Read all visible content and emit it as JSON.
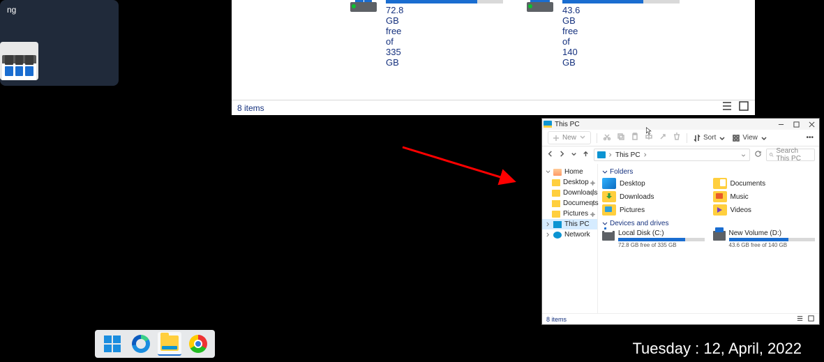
{
  "tl_card": {
    "title_line1": "ng"
  },
  "bg_explorer": {
    "drive1": {
      "capacity_text": "72.8 GB free of 335 GB",
      "fill_pct": 78
    },
    "drive2": {
      "capacity_text": "43.6 GB free of 140 GB",
      "fill_pct": 69
    },
    "status_items": "8 items"
  },
  "sm_explorer": {
    "title": "This PC",
    "toolbar": {
      "new_label": "New",
      "sort_label": "Sort",
      "view_label": "View"
    },
    "breadcrumb": "This PC",
    "search_placeholder": "Search This PC",
    "nav": {
      "home": "Home",
      "desktop": "Desktop",
      "downloads": "Downloads",
      "documents": "Documents",
      "pictures": "Pictures",
      "this_pc": "This PC",
      "network": "Network"
    },
    "sections": {
      "folders": "Folders",
      "devices": "Devices and drives"
    },
    "folders": {
      "desktop": "Desktop",
      "documents": "Documents",
      "downloads": "Downloads",
      "music": "Music",
      "pictures": "Pictures",
      "videos": "Videos"
    },
    "drives": {
      "d1": {
        "name": "Local Disk (C:)",
        "cap": "72.8 GB free of 335 GB",
        "fill_pct": 78
      },
      "d2": {
        "name": "New Volume (D:)",
        "cap": "43.6 GB free of 140 GB",
        "fill_pct": 69
      }
    },
    "status_items": "8 items"
  },
  "date_string": "Tuesday : 12, April, 2022"
}
